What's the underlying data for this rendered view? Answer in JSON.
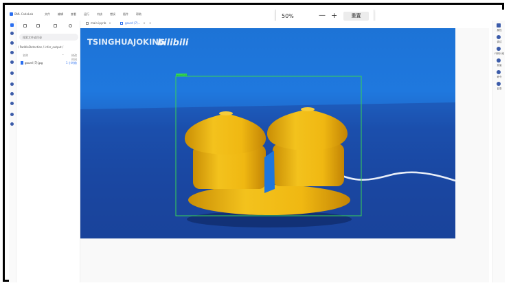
{
  "app": {
    "title": "BML CodeLab"
  },
  "menu": [
    "文件",
    "编辑",
    "查看",
    "运行",
    "内核",
    "错误",
    "插件",
    "帮助"
  ],
  "zoom": {
    "value": "50%",
    "minus": "—",
    "plus": "+",
    "reset": "重置"
  },
  "sidebar": {
    "search_placeholder": "搜索文件或目录",
    "path": "/ PaddleDetection / infer_output /",
    "columns": {
      "name": "名称",
      "modified": "修改时间"
    },
    "files": [
      {
        "name": "gourd (7).jpg",
        "size": "1 小时前"
      }
    ]
  },
  "tabs": [
    {
      "label": "main.ipynb",
      "active": false
    },
    {
      "label": "gourd (7)...",
      "active": true
    }
  ],
  "photo": {
    "watermark_text": "TSINGHUAJOKING",
    "watermark_logo": "bilibili",
    "detection_label": "gourd 0.98",
    "colors": {
      "box": "#39d353",
      "object": "#f0bb16",
      "wall": "#1f76dc",
      "floor": "#1a46a0"
    }
  },
  "rightbar": [
    "属性",
    "调试",
    "代码片段",
    "变量",
    "命令",
    "目录"
  ]
}
